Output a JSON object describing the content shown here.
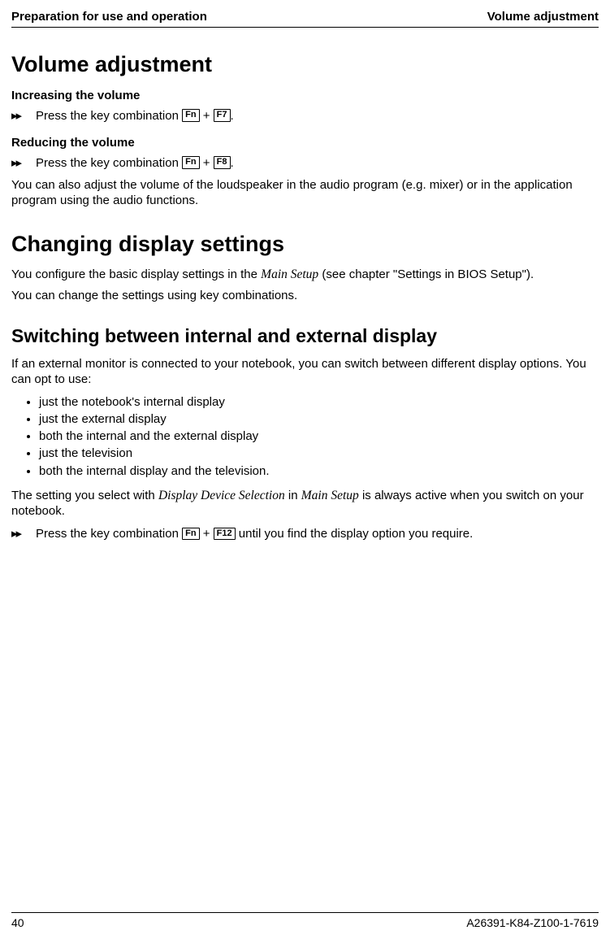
{
  "header": {
    "left": "Preparation for use and operation",
    "right": "Volume adjustment"
  },
  "h1": "Volume adjustment",
  "increase": {
    "heading": "Increasing the volume",
    "step_prefix": "Press the key combination ",
    "key1": "Fn",
    "plus": " + ",
    "key2": "F7",
    "suffix": "."
  },
  "reduce": {
    "heading": "Reducing the volume",
    "step_prefix": "Press the key combination ",
    "key1": "Fn",
    "plus": " + ",
    "key2": "F8",
    "suffix": "."
  },
  "volume_para": "You can also adjust the volume of the loudspeaker in the audio program (e.g. mixer) or in the application program using the audio functions.",
  "display": {
    "heading": "Changing display settings",
    "para1_pre": "You configure the basic display settings in the ",
    "para1_em": "Main Setup",
    "para1_post": " (see chapter \"Settings in BIOS Setup\").",
    "para2": "You can change the settings using key combinations."
  },
  "switch": {
    "heading": "Switching between internal and external display",
    "intro": "If an external monitor is connected to your notebook, you can switch between different display options. You can opt to use:",
    "bullets": [
      "just the notebook's internal display",
      "just the external display",
      "both the internal and the external display",
      "just the television",
      "both the internal display and the television."
    ],
    "note_pre": "The setting you select with ",
    "note_em1": "Display Device Selection",
    "note_mid": " in ",
    "note_em2": "Main Setup",
    "note_post": " is always active when you switch on your notebook.",
    "step_prefix": "Press the key combination ",
    "key1": "Fn",
    "plus": " + ",
    "key2": "F12",
    "step_suffix": " until you find the display option you require."
  },
  "footer": {
    "page": "40",
    "docid": "A26391-K84-Z100-1-7619"
  },
  "glyphs": {
    "step": "▸▸"
  }
}
